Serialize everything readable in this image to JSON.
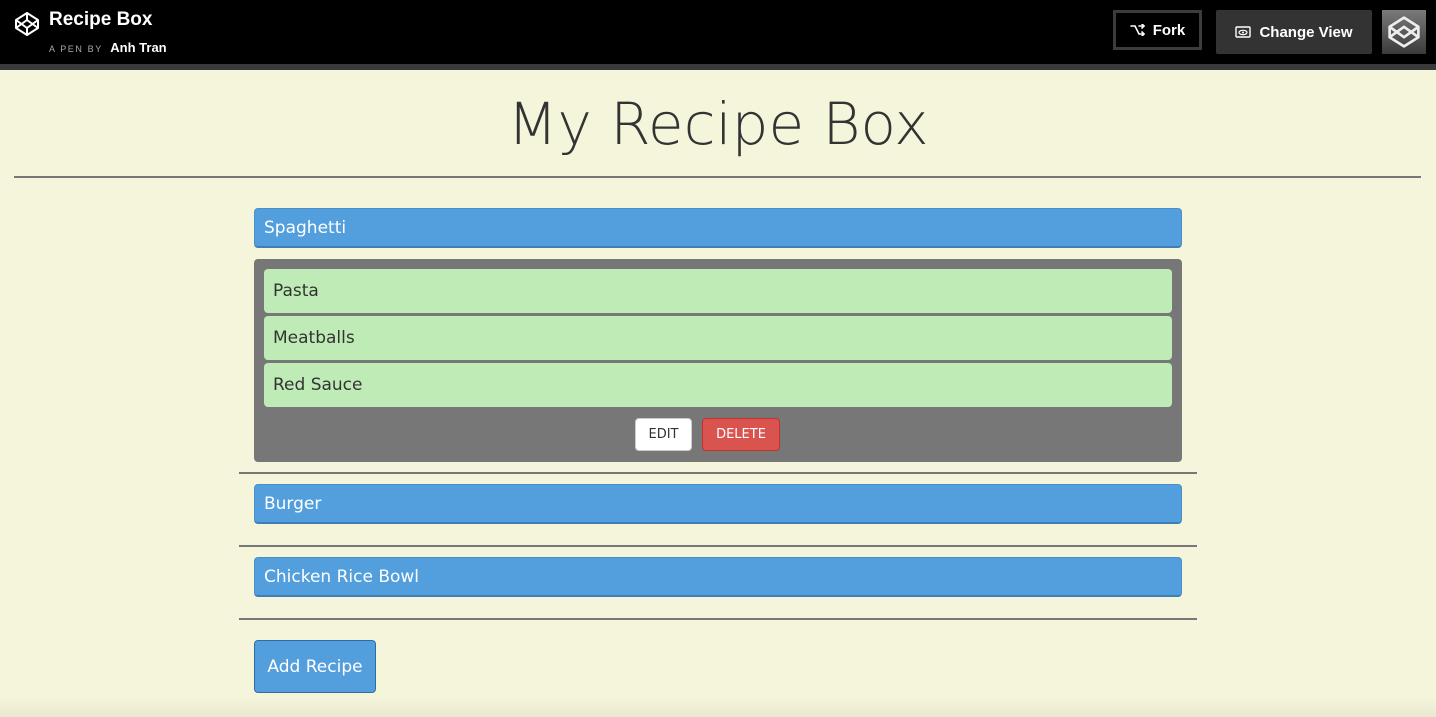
{
  "topbar": {
    "title": "Recipe Box",
    "byline_prefix": "A PEN BY",
    "author": "Anh Tran",
    "fork_label": "Fork",
    "change_view_label": "Change View"
  },
  "page_title": "My Recipe Box",
  "recipes": [
    {
      "name": "Spaghetti",
      "ingredients": [
        "Pasta",
        "Meatballs",
        "Red Sauce"
      ],
      "expanded": true
    },
    {
      "name": "Burger"
    },
    {
      "name": "Chicken Rice Bowl"
    }
  ],
  "actions": {
    "edit_label": "EDIT",
    "delete_label": "DELETE",
    "add_label": "Add Recipe"
  },
  "colors": {
    "page_background": "#f5f5dc",
    "recipe_header": "#539fdd",
    "ingredient": "#bfecb6",
    "recipe_body": "#777777",
    "delete": "#d9534f"
  },
  "icons": {
    "logo": "codepen-logo-icon",
    "fork": "fork-icon",
    "change_view": "eye-icon",
    "avatar": "user-avatar"
  }
}
